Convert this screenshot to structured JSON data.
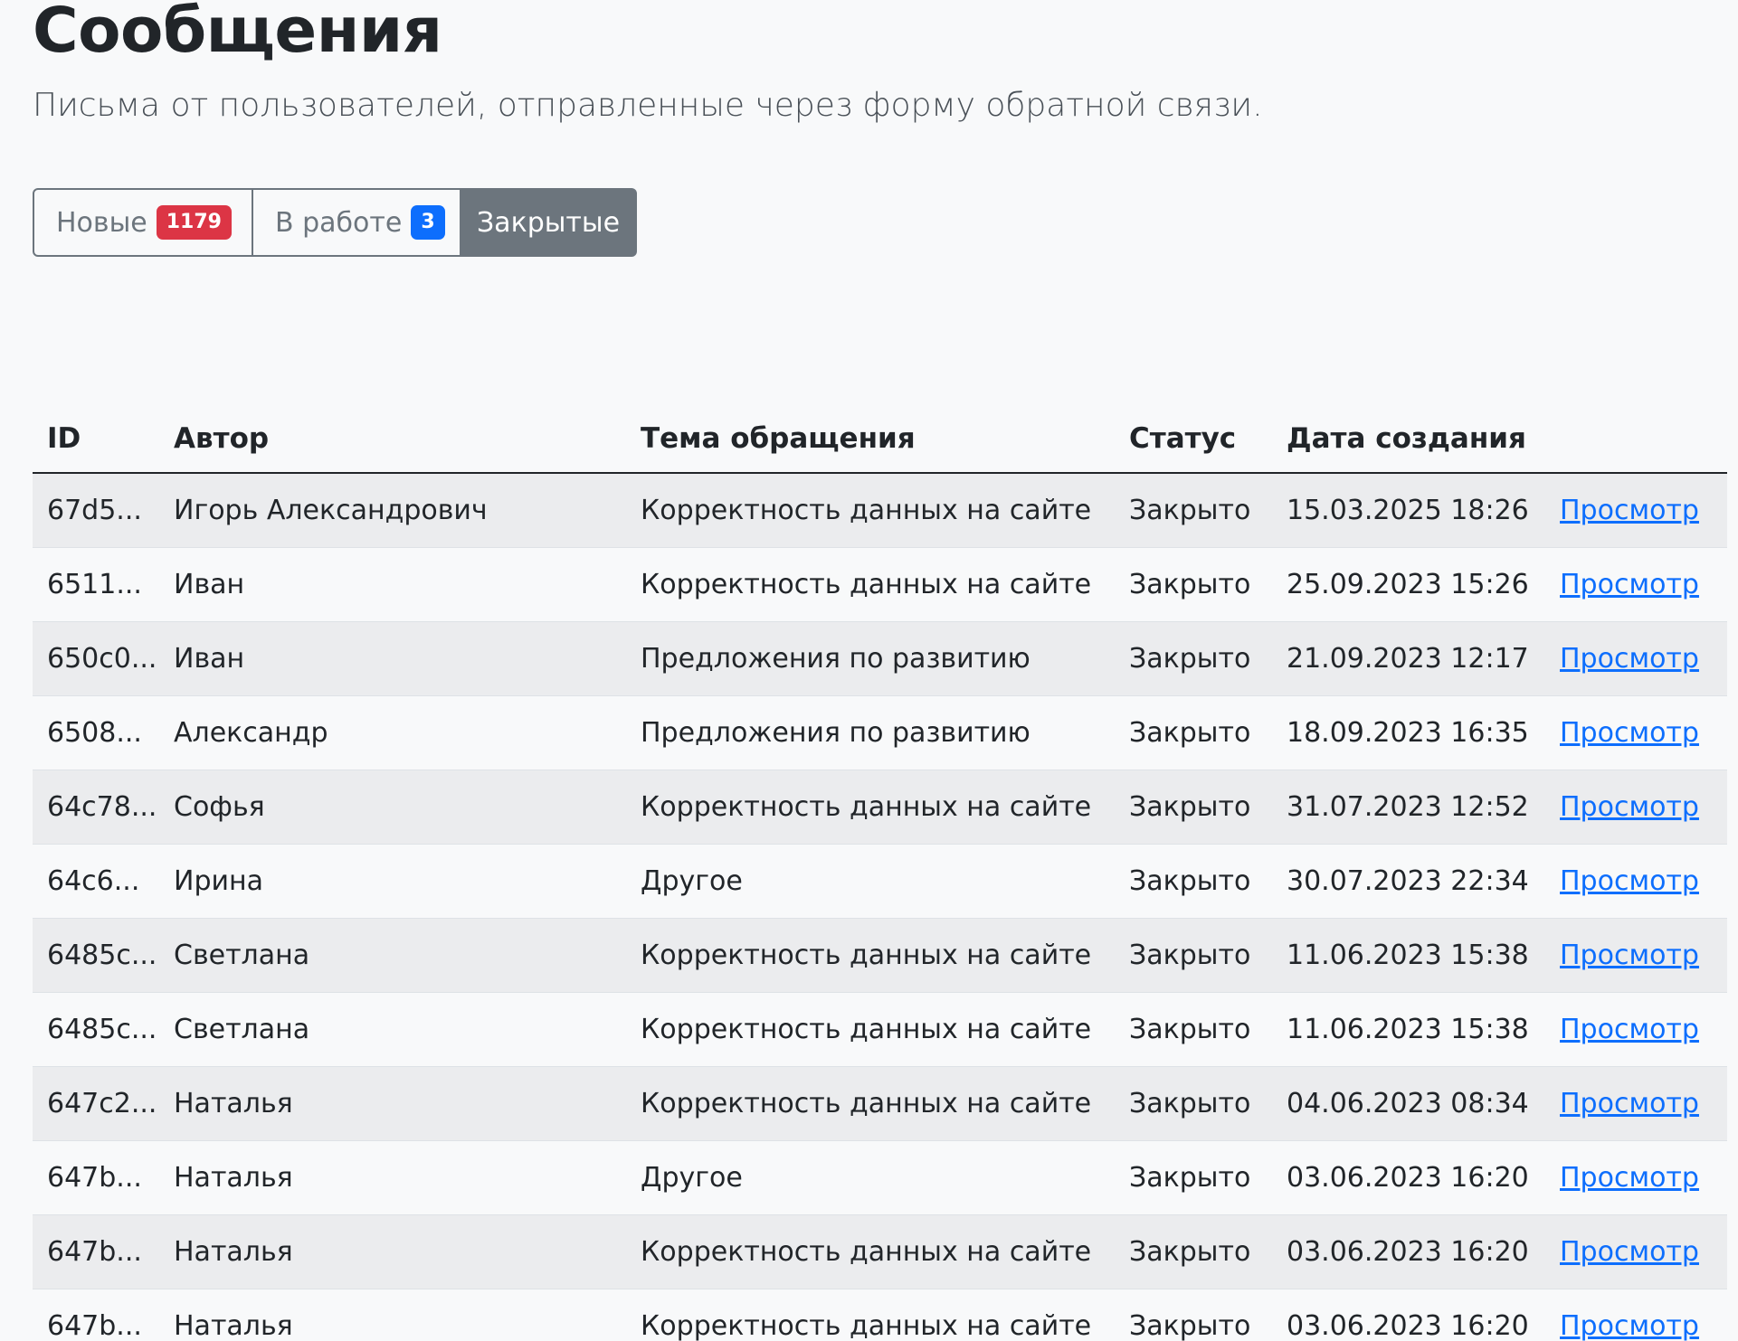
{
  "header": {
    "title": "Сообщения",
    "subtitle": "Письма от пользователей, отправленные через форму обратной связи."
  },
  "tabs": [
    {
      "label": "Новые",
      "badge": "1179",
      "badge_color": "#dc3545",
      "active": false
    },
    {
      "label": "В работе",
      "badge": "3",
      "badge_color": "#0d6efd",
      "active": false
    },
    {
      "label": "Закрытые",
      "active": true
    }
  ],
  "table": {
    "columns": [
      "ID",
      "Автор",
      "Тема обращения",
      "Статус",
      "Дата создания",
      ""
    ],
    "rows": [
      {
        "id": "67d5...",
        "author": "Игорь Александрович",
        "subject": "Корректность данных на сайте",
        "status": "Закрыто",
        "date": "15.03.2025 18:26",
        "action": "Просмотр"
      },
      {
        "id": "6511...",
        "author": "Иван",
        "subject": "Корректность данных на сайте",
        "status": "Закрыто",
        "date": "25.09.2023 15:26",
        "action": "Просмотр"
      },
      {
        "id": "650c0...",
        "author": "Иван",
        "subject": "Предложения по развитию",
        "status": "Закрыто",
        "date": "21.09.2023 12:17",
        "action": "Просмотр"
      },
      {
        "id": "6508...",
        "author": "Александр",
        "subject": "Предложения по развитию",
        "status": "Закрыто",
        "date": "18.09.2023 16:35",
        "action": "Просмотр"
      },
      {
        "id": "64c78...",
        "author": "Софья",
        "subject": "Корректность данных на сайте",
        "status": "Закрыто",
        "date": "31.07.2023 12:52",
        "action": "Просмотр"
      },
      {
        "id": "64c6...",
        "author": "Ирина",
        "subject": "Другое",
        "status": "Закрыто",
        "date": "30.07.2023 22:34",
        "action": "Просмотр"
      },
      {
        "id": "6485c...",
        "author": "Светлана",
        "subject": "Корректность данных на сайте",
        "status": "Закрыто",
        "date": "11.06.2023 15:38",
        "action": "Просмотр"
      },
      {
        "id": "6485c...",
        "author": "Светлана",
        "subject": "Корректность данных на сайте",
        "status": "Закрыто",
        "date": "11.06.2023 15:38",
        "action": "Просмотр"
      },
      {
        "id": "647c2...",
        "author": "Наталья",
        "subject": "Корректность данных на сайте",
        "status": "Закрыто",
        "date": "04.06.2023 08:34",
        "action": "Просмотр"
      },
      {
        "id": "647b...",
        "author": "Наталья",
        "subject": "Другое",
        "status": "Закрыто",
        "date": "03.06.2023 16:20",
        "action": "Просмотр"
      },
      {
        "id": "647b...",
        "author": "Наталья",
        "subject": "Корректность данных на сайте",
        "status": "Закрыто",
        "date": "03.06.2023 16:20",
        "action": "Просмотр"
      },
      {
        "id": "647b...",
        "author": "Наталья",
        "subject": "Корректность данных на сайте",
        "status": "Закрыто",
        "date": "03.06.2023 16:20",
        "action": "Просмотр"
      }
    ]
  }
}
